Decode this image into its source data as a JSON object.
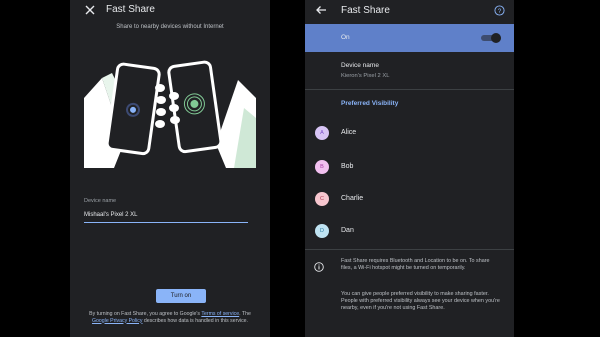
{
  "left": {
    "title": "Fast Share",
    "subtitle": "Share to nearby devices without Internet",
    "device_name_label": "Device name",
    "device_name_value": "Mishaal's Pixel 2 XL",
    "turn_on_button": "Turn on",
    "footer": {
      "t1": "By turning on Fast Share, you agree to Google's ",
      "link1": "Terms of service",
      "t2": ". The ",
      "link2": "Google Privacy Policy",
      "t3": " describes how data is handled in this service."
    }
  },
  "right": {
    "title": "Fast Share",
    "on_label": "On",
    "toggle_on": true,
    "device_name_label": "Device name",
    "device_name_value": "Kieron's Pixel 2 XL",
    "preferred_visibility": "Preferred Visibility",
    "contacts": [
      {
        "initial": "A",
        "name": "Alice",
        "color": "#d7c4f5",
        "text_color": "#7b4fc9"
      },
      {
        "initial": "B",
        "name": "Bob",
        "color": "#f2c0f0",
        "text_color": "#a63aa3"
      },
      {
        "initial": "C",
        "name": "Charlie",
        "color": "#f7c6cf",
        "text_color": "#b03a52"
      },
      {
        "initial": "D",
        "name": "Dan",
        "color": "#bfe3f2",
        "text_color": "#2e7ea3"
      }
    ],
    "info_1": "Fast Share requires Bluetooth and Location to be on. To share files, a Wi-Fi hotspot might be turned on temporarily.",
    "info_2": "You can give people preferred visibility to make sharing faster. People with preferred visibility always see your device when you're nearby, even if you're not using Fast Share."
  },
  "colors": {
    "accent": "#8ab4f8",
    "background": "#202124",
    "selected_row": "#5f80c9"
  },
  "icons": [
    "close-icon",
    "back-icon",
    "help-icon",
    "info-icon"
  ]
}
